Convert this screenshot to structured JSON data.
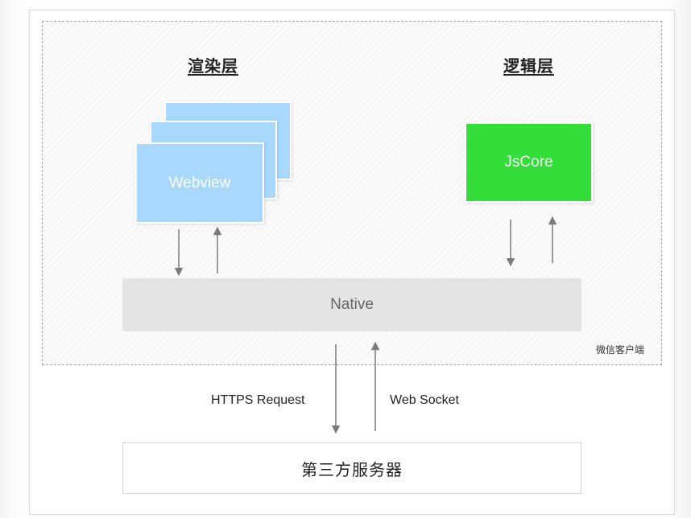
{
  "render_layer": {
    "title": "渲染层",
    "webview_label": "Webview"
  },
  "logic_layer": {
    "title": "逻辑层",
    "jscore_label": "JsCore"
  },
  "native": {
    "label": "Native"
  },
  "client": {
    "label": "微信客户端"
  },
  "network": {
    "https_label": "HTTPS Request",
    "websocket_label": "Web Socket"
  },
  "server": {
    "label": "第三方服务器"
  },
  "colors": {
    "webview": "#a8d8fb",
    "jscore": "#35dd3a",
    "native": "#e4e4e4",
    "arrow": "#7a7a7a"
  }
}
